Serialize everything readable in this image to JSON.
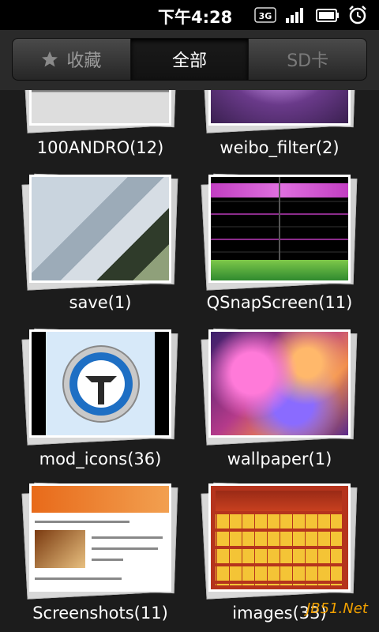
{
  "status_bar": {
    "time": "下午4:28",
    "network": "3G",
    "icons": [
      "3g-icon",
      "signal-icon",
      "battery-icon",
      "alarm-icon"
    ]
  },
  "tabs": [
    {
      "label": "收藏",
      "icon": "star-icon",
      "active": false
    },
    {
      "label": "全部",
      "active": true
    },
    {
      "label": "SD卡",
      "active": false
    }
  ],
  "albums": [
    {
      "label": "100ANDRO(12)"
    },
    {
      "label": "weibo_filter(2)"
    },
    {
      "label": "save(1)"
    },
    {
      "label": "QSnapScreen(11)"
    },
    {
      "label": "mod_icons(36)"
    },
    {
      "label": "wallpaper(1)"
    },
    {
      "label": "Screenshots(11)"
    },
    {
      "label": "images(33)"
    }
  ],
  "watermark": "JB51.Net",
  "colors": {
    "background": "#1c1c1c",
    "tab_active_text": "#ffffff",
    "tab_inactive_text": "#9a9a9a",
    "watermark": "#f0a000"
  }
}
